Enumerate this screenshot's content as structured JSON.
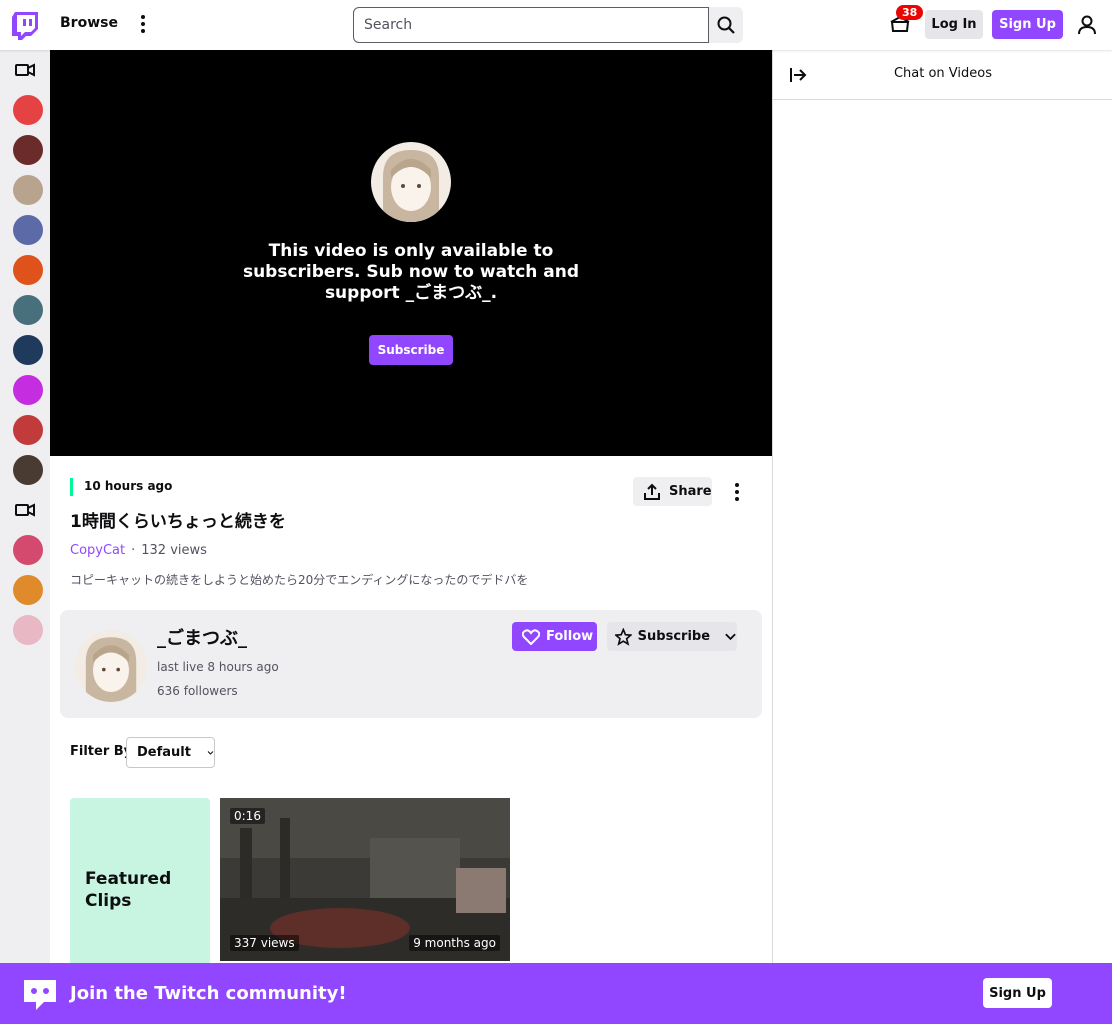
{
  "nav": {
    "browse_label": "Browse",
    "search_placeholder": "Search",
    "notifications_count": "38",
    "login_label": "Log In",
    "signup_label": "Sign Up"
  },
  "sidebar": {
    "sections": [
      {
        "icon": "video-camera-icon",
        "channels": [
          "channel-1",
          "channel-2",
          "channel-3",
          "channel-4",
          "channel-5",
          "channel-6",
          "channel-7",
          "channel-8",
          "channel-9",
          "channel-10"
        ]
      },
      {
        "icon": "video-camera-icon",
        "channels": [
          "channel-11",
          "channel-12",
          "channel-13"
        ]
      }
    ]
  },
  "player": {
    "message": "This video is only available to subscribers. Sub now to watch and support _ごまつぶ_.",
    "subscribe_label": "Subscribe"
  },
  "chat": {
    "title": "Chat on Videos"
  },
  "video": {
    "time_ago": "10 hours ago",
    "share_label": "Share",
    "title": "1時間くらいちょっと続きを",
    "category": "CopyCat",
    "views": "132 views",
    "description": "コピーキャットの続きをしようと始めたら20分でエンディングになったのでデドバを"
  },
  "channel": {
    "name": "_ごまつぶ_",
    "last_live": "last live 8 hours ago",
    "followers": "636 followers",
    "follow_label": "Follow",
    "subscribe_label": "Subscribe"
  },
  "filter": {
    "label": "Filter By",
    "selected": "Default"
  },
  "clips": {
    "featured_label": "Featured Clips",
    "items": [
      {
        "duration": "0:16",
        "views": "337 views",
        "age": "9 months ago"
      }
    ]
  },
  "banner": {
    "text": "Join the Twitch community!",
    "signup_label": "Sign Up"
  },
  "colors": {
    "brand": "#9147ff",
    "accent_green": "#00f593",
    "badge_red": "#eb0400"
  }
}
